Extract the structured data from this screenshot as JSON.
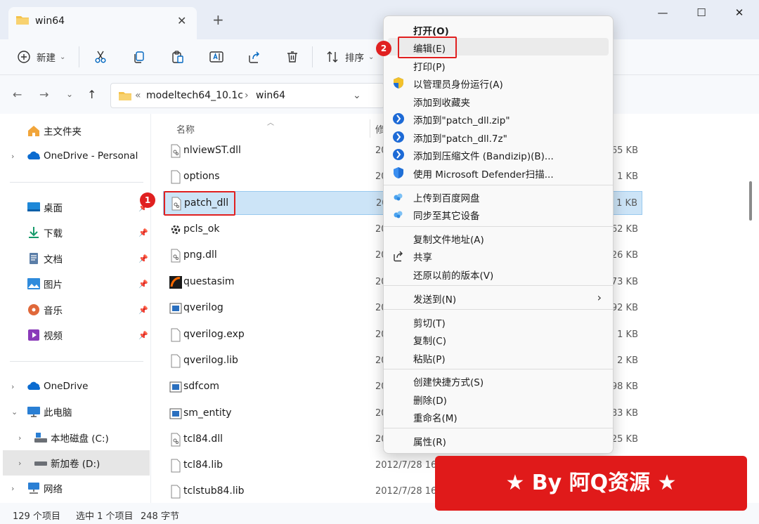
{
  "window": {
    "tab_title": "win64",
    "tab_close": "✕",
    "new_tab": "+",
    "minimize": "—",
    "maximize": "☐",
    "close": "✕"
  },
  "toolbar": {
    "new_label": "新建",
    "sort_label": "排序"
  },
  "address": {
    "chevrons": "«",
    "crumbs": [
      "modeltech64_10.1c",
      "win64"
    ],
    "separator": "›"
  },
  "sidebar": {
    "items": [
      {
        "label": "主文件夹",
        "icon": "home-icon"
      },
      {
        "label": "OneDrive - Personal",
        "icon": "onedrive-icon"
      },
      {
        "label": "桌面",
        "icon": "desktop-icon"
      },
      {
        "label": "下载",
        "icon": "download-icon"
      },
      {
        "label": "文档",
        "icon": "documents-icon"
      },
      {
        "label": "图片",
        "icon": "pictures-icon"
      },
      {
        "label": "音乐",
        "icon": "music-icon"
      },
      {
        "label": "视频",
        "icon": "videos-icon"
      },
      {
        "label": "OneDrive",
        "icon": "onedrive-icon"
      },
      {
        "label": "此电脑",
        "icon": "this-pc-icon"
      },
      {
        "label": "本地磁盘 (C:)",
        "icon": "drive-icon"
      },
      {
        "label": "新加卷 (D:)",
        "icon": "drive-icon"
      },
      {
        "label": "网络",
        "icon": "network-icon"
      }
    ]
  },
  "filelist": {
    "col_name": "名称",
    "col_modified": "修",
    "rows": [
      {
        "name": "nlviewST.dll",
        "date": "20",
        "size": "65 KB",
        "icon": "dll-file-icon"
      },
      {
        "name": "options",
        "date": "20",
        "size": "1 KB",
        "icon": "file-icon"
      },
      {
        "name": "patch_dll",
        "date": "20",
        "size": "1 KB",
        "icon": "dll-file-icon"
      },
      {
        "name": "pcls_ok",
        "date": "20",
        "size": "62 KB",
        "icon": "gear-app-icon"
      },
      {
        "name": "png.dll",
        "date": "20",
        "size": "26 KB",
        "icon": "dll-file-icon"
      },
      {
        "name": "questasim",
        "date": "20",
        "size": "73 KB",
        "icon": "questasim-icon"
      },
      {
        "name": "qverilog",
        "date": "20",
        "size": "92 KB",
        "icon": "app-icon"
      },
      {
        "name": "qverilog.exp",
        "date": "20",
        "size": "1 KB",
        "icon": "file-icon"
      },
      {
        "name": "qverilog.lib",
        "date": "20",
        "size": "2 KB",
        "icon": "file-icon"
      },
      {
        "name": "sdfcom",
        "date": "20",
        "size": "98 KB",
        "icon": "app-icon"
      },
      {
        "name": "sm_entity",
        "date": "20",
        "size": "83 KB",
        "icon": "app-icon"
      },
      {
        "name": "tcl84.dll",
        "date": "20",
        "size": "25 KB",
        "icon": "dll-file-icon"
      },
      {
        "name": "tcl84.lib",
        "date": "2012/7/28 16",
        "size": "",
        "icon": "file-icon"
      },
      {
        "name": "tclstub84.lib",
        "date": "2012/7/28 16",
        "size": "",
        "icon": "file-icon"
      }
    ]
  },
  "context_menu": {
    "items": [
      {
        "label": "打开(O)",
        "bold": true
      },
      {
        "label": "编辑(E)"
      },
      {
        "label": "打印(P)"
      },
      {
        "label": "以管理员身份运行(A)",
        "icon": "uac-shield-icon"
      },
      {
        "label": "添加到收藏夹"
      },
      {
        "label": "添加到\"patch_dll.zip\"",
        "icon": "bandizip-icon"
      },
      {
        "label": "添加到\"patch_dll.7z\"",
        "icon": "bandizip-icon"
      },
      {
        "label": "添加到压缩文件 (Bandizip)(B)...",
        "icon": "bandizip-icon"
      },
      {
        "label": "使用 Microsoft Defender扫描...",
        "icon": "defender-icon"
      },
      {
        "label": "上传到百度网盘",
        "icon": "baidu-cloud-icon"
      },
      {
        "label": "同步至其它设备",
        "icon": "baidu-cloud-icon"
      },
      {
        "label": "复制文件地址(A)"
      },
      {
        "label": "共享",
        "icon": "share-icon"
      },
      {
        "label": "还原以前的版本(V)"
      },
      {
        "label": "发送到(N)",
        "submenu": "›"
      },
      {
        "label": "剪切(T)"
      },
      {
        "label": "复制(C)"
      },
      {
        "label": "粘贴(P)"
      },
      {
        "label": "创建快捷方式(S)"
      },
      {
        "label": "删除(D)"
      },
      {
        "label": "重命名(M)"
      },
      {
        "label": "属性(R)"
      }
    ]
  },
  "annotations": {
    "badge1": "1",
    "badge2": "2"
  },
  "status": {
    "count": "129 个项目",
    "selected": "选中 1 个项目",
    "size": "248 字节"
  },
  "banner": "★ By 阿Q资源 ★",
  "colors": {
    "accent": "#0067c0",
    "selection": "#cce4f7",
    "annotation_red": "#e02020",
    "banner_red": "#e01a1a",
    "folder_yellow": "#f4c24b"
  }
}
